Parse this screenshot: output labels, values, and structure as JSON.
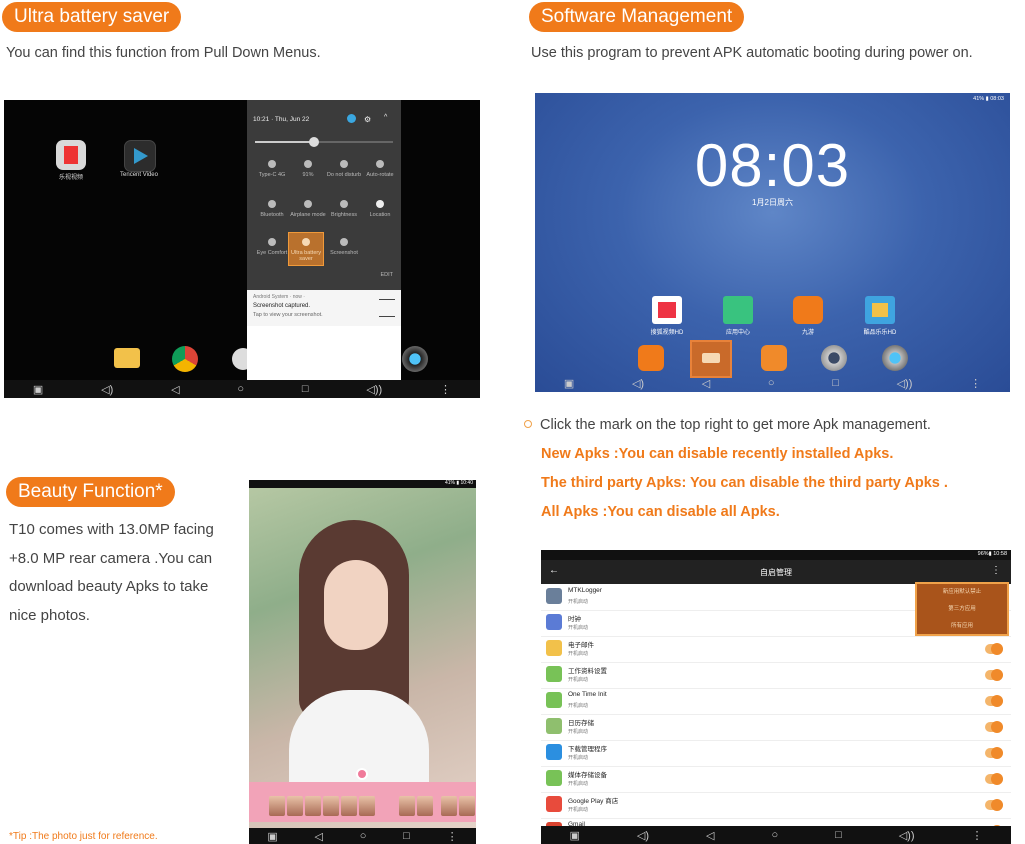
{
  "battery": {
    "heading": "Ultra battery saver",
    "desc": "You can find this function from Pull Down Menus.",
    "shade_time": "10:21 · Thu, Jun 22",
    "tiles": [
      "Type-C 4G",
      "91%",
      "Do not disturb",
      "Auto-rotate",
      "Bluetooth",
      "Airplane mode",
      "Brightness",
      "Location",
      "Eye Comfort",
      "Ultra battery saver",
      "Screenshot"
    ],
    "edit": "EDIT",
    "notif_source": "Android System · now ·",
    "notif_title": "Screenshot captured.",
    "notif_text": "Tap to view your screenshot.",
    "apps": [
      "乐视视频",
      "Tencent Video"
    ]
  },
  "software": {
    "heading": "Software Management",
    "desc": "Use this program to prevent APK automatic booting during power on.",
    "status_right": "41% ▮ 08:03",
    "clock": "08:03",
    "date": "1月2日周六",
    "apps": [
      "搜狐视频HD",
      "应用中心",
      "九游",
      "酷品乐乐HD"
    ],
    "bullet": "Click the mark on the top right to get more Apk management.",
    "lines": [
      "New Apks :You can disable recently installed Apks.",
      "The third party Apks: You can disable the third party Apks .",
      "All Apks :You can disable all Apks."
    ]
  },
  "manager": {
    "status_right": "96%▮ 10:58",
    "title": "自启管理",
    "menu": [
      "新应用默认禁止",
      "第三方应用",
      "所有应用"
    ],
    "rows": [
      {
        "name": "MTKLogger",
        "sub": "开机启动",
        "color": "#6a7f9a",
        "toggle": false
      },
      {
        "name": "时钟",
        "sub": "开机启动",
        "color": "#5b7bd5",
        "toggle": false
      },
      {
        "name": "电子邮件",
        "sub": "开机启动",
        "color": "#f2c14a",
        "toggle": true
      },
      {
        "name": "工作资料设置",
        "sub": "开机启动",
        "color": "#78c257",
        "toggle": true
      },
      {
        "name": "One Time Init",
        "sub": "开机启动",
        "color": "#78c257",
        "toggle": true
      },
      {
        "name": "日历存储",
        "sub": "开机启动",
        "color": "#8fbf6e",
        "toggle": true
      },
      {
        "name": "下载管理程序",
        "sub": "开机启动",
        "color": "#2b8fe0",
        "toggle": true
      },
      {
        "name": "媒体存储设备",
        "sub": "开机启动",
        "color": "#78c257",
        "toggle": true
      },
      {
        "name": "Google Play 商店",
        "sub": "开机启动",
        "color": "#e84b3c",
        "toggle": true
      },
      {
        "name": "Gmail",
        "sub": "",
        "color": "#d9432f",
        "toggle": true
      }
    ]
  },
  "beauty": {
    "heading": "Beauty Function*",
    "lines": [
      "T10 comes with 13.0MP facing",
      "+8.0 MP rear camera .You can",
      "download beauty Apks to take",
      "nice photos."
    ],
    "tip": "*Tip :The photo just for reference.",
    "status_right": "41% ▮ 10:40"
  }
}
